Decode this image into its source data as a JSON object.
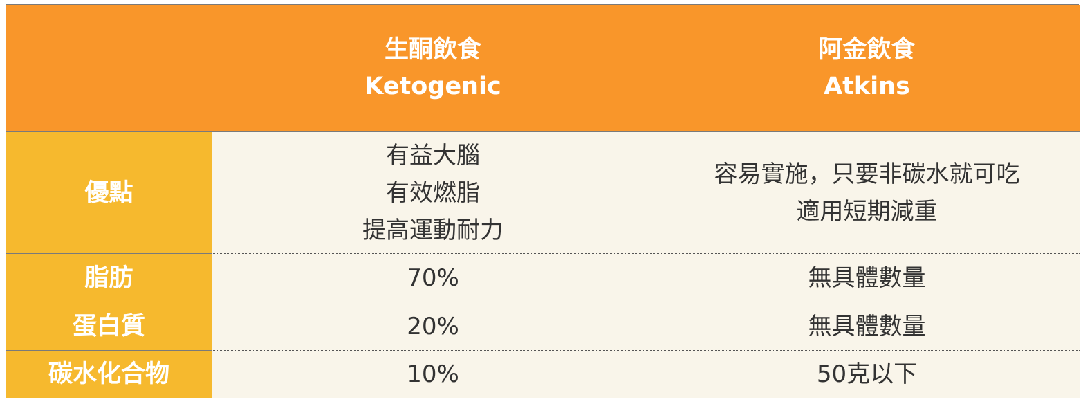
{
  "header": {
    "corner": "",
    "col1_line1": "生酮飲食",
    "col1_line2": "Ketogenic",
    "col2_line1": "阿金飲食",
    "col2_line2": "Atkins"
  },
  "rows": [
    {
      "label": "優點",
      "keto": [
        "有益大腦",
        "有效燃脂",
        "提高運動耐力"
      ],
      "atkins": [
        "容易實施，只要非碳水就可吃",
        "適用短期減重"
      ]
    },
    {
      "label": "脂肪",
      "keto": "70%",
      "atkins": "無具體數量"
    },
    {
      "label": "蛋白質",
      "keto": "20%",
      "atkins": "無具體數量"
    },
    {
      "label": "碳水化合物",
      "keto": "10%",
      "atkins": "50克以下"
    }
  ],
  "colors": {
    "header_bg": "#f9962a",
    "rowhead_bg": "#f6b92e",
    "body_bg": "#f9f5ea",
    "text_white": "#ffffff",
    "text_dark": "#333333"
  }
}
